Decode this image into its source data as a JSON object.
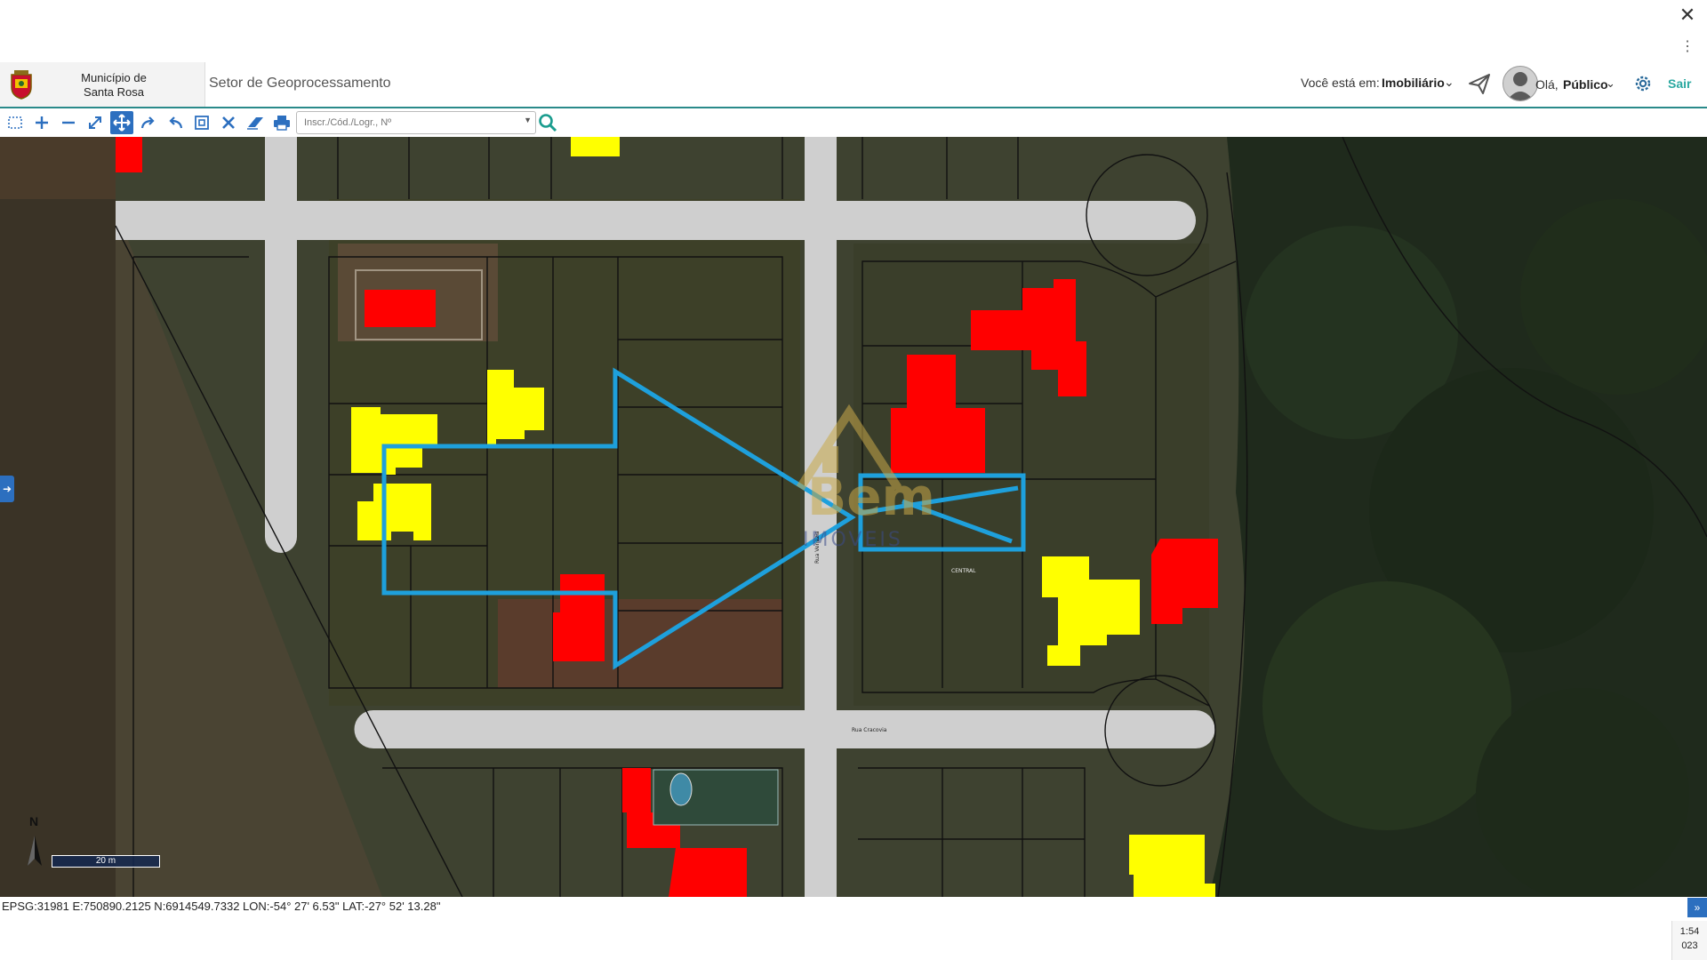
{
  "window": {
    "close_glyph": "✕",
    "menu_glyph": "⋮"
  },
  "header": {
    "municipality": "Município de Santa Rosa",
    "sector": "Setor de Geoprocessamento",
    "location_label": "Você está em:",
    "location_value": "Imobiliário",
    "greeting": "Olá,",
    "user": "Público",
    "logout": "Sair"
  },
  "toolbar": {
    "tools": [
      "select-box-icon",
      "zoom-in-icon",
      "zoom-out-icon",
      "full-extent-icon",
      "pan-icon",
      "redo-icon",
      "undo-icon",
      "zoom-window-icon",
      "clear-icon",
      "eraser-icon",
      "print-icon"
    ],
    "active_tool": "pan-icon",
    "search_placeholder": "Inscr./Cód./Logr., Nº"
  },
  "map": {
    "street_labels": [
      "Rua Venezia",
      "Rua Cracovia",
      "CENTRAL"
    ],
    "watermark": {
      "brand": "Bem",
      "sub": "IMÓVEIS"
    },
    "north_label": "N",
    "scale_label": "20 m",
    "colors": {
      "highlight": "#1ea0dc",
      "building_red": "#ff0000",
      "building_yellow": "#ffff00",
      "road": "#cfcfcf"
    }
  },
  "footer": {
    "coordinates": "EPSG:31981 E:750890.2125 N:6914549.7332 LON:-54° 27' 6.53\" LAT:-27° 52' 13.28\"",
    "clock_time": "1:54",
    "clock_year": "023"
  }
}
